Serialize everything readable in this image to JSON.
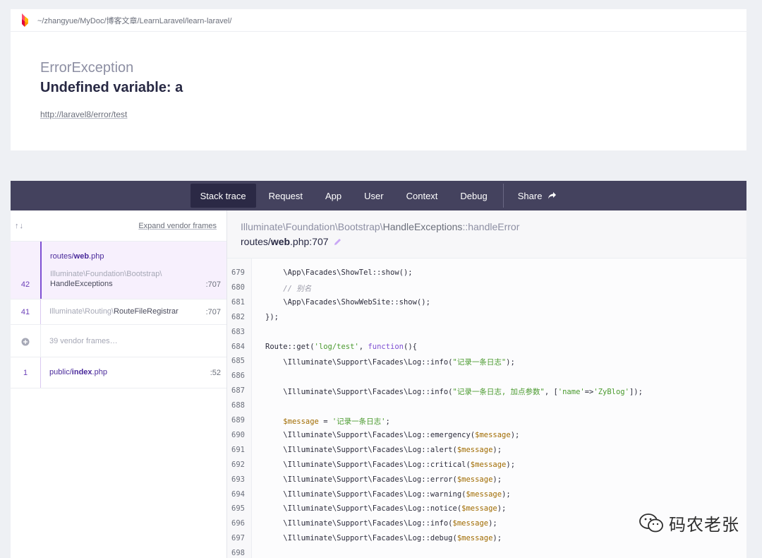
{
  "header": {
    "path": "~/zhangyue/MyDoc/博客文章/LearnLaravel/learn-laravel/",
    "exception_class": "ErrorException",
    "exception_message": "Undefined variable: a",
    "url": "http://laravel8/error/test"
  },
  "tabs": {
    "stack_trace": "Stack trace",
    "request": "Request",
    "app": "App",
    "user": "User",
    "context": "Context",
    "debug": "Debug",
    "share": "Share"
  },
  "stack": {
    "sort_arrows": "↑↓",
    "expand_label": "Expand vendor frames",
    "frames": [
      {
        "number": "42",
        "title_prefix": "routes/",
        "title_bold": "web",
        "title_suffix": ".php",
        "class": "Illuminate\\Foundation\\Bootstrap\\",
        "function": "HandleExceptions",
        "line": ":707"
      },
      {
        "number": "41",
        "class": "Illuminate\\Routing\\",
        "function": "RouteFileRegistrar",
        "line": ":707"
      },
      {
        "vendor_label": "39 vendor frames…"
      },
      {
        "number": "1",
        "title_prefix": "public/",
        "title_bold": "index",
        "title_suffix": ".php",
        "line": ":52"
      }
    ]
  },
  "code": {
    "namespace": "Illuminate\\Foundation\\Bootstrap\\",
    "class_name": "HandleExceptions",
    "method": "::handleError",
    "file_prefix": "routes/",
    "file_bold": "web",
    "file_suffix": ".php:707",
    "lines": [
      {
        "n": "679",
        "t": "    \\App\\Facades\\ShowTel::show();"
      },
      {
        "n": "680",
        "t": "    // 别名"
      },
      {
        "n": "681",
        "t": "    \\App\\Facades\\ShowWebSite::show();"
      },
      {
        "n": "682",
        "t": "});"
      },
      {
        "n": "683",
        "t": ""
      },
      {
        "n": "684",
        "t": "Route::get('log/test', function(){"
      },
      {
        "n": "685",
        "t": "    \\Illuminate\\Support\\Facades\\Log::info(\"记录一条日志\");"
      },
      {
        "n": "686",
        "t": ""
      },
      {
        "n": "687",
        "t": "    \\Illuminate\\Support\\Facades\\Log::info(\"记录一条日志, 加点参数\", ['name'=>'ZyBlog']);"
      },
      {
        "n": "688",
        "t": ""
      },
      {
        "n": "689",
        "t": "    $message = '记录一条日志';"
      },
      {
        "n": "690",
        "t": "    \\Illuminate\\Support\\Facades\\Log::emergency($message);"
      },
      {
        "n": "691",
        "t": "    \\Illuminate\\Support\\Facades\\Log::alert($message);"
      },
      {
        "n": "692",
        "t": "    \\Illuminate\\Support\\Facades\\Log::critical($message);"
      },
      {
        "n": "693",
        "t": "    \\Illuminate\\Support\\Facades\\Log::error($message);"
      },
      {
        "n": "694",
        "t": "    \\Illuminate\\Support\\Facades\\Log::warning($message);"
      },
      {
        "n": "695",
        "t": "    \\Illuminate\\Support\\Facades\\Log::notice($message);"
      },
      {
        "n": "696",
        "t": "    \\Illuminate\\Support\\Facades\\Log::info($message);"
      },
      {
        "n": "697",
        "t": "    \\Illuminate\\Support\\Facades\\Log::debug($message);"
      },
      {
        "n": "698",
        "t": ""
      }
    ]
  },
  "watermark": {
    "text": "码农老张",
    "icon": "wechat-icon"
  },
  "colors": {
    "tabbar_bg": "#44425e",
    "tab_active_bg": "#2b2945",
    "accent_purple": "#7e4fd3",
    "selected_frame_bg": "#f7f0fd",
    "string_green": "#4a9a2e",
    "variable_orange": "#a06b00"
  }
}
